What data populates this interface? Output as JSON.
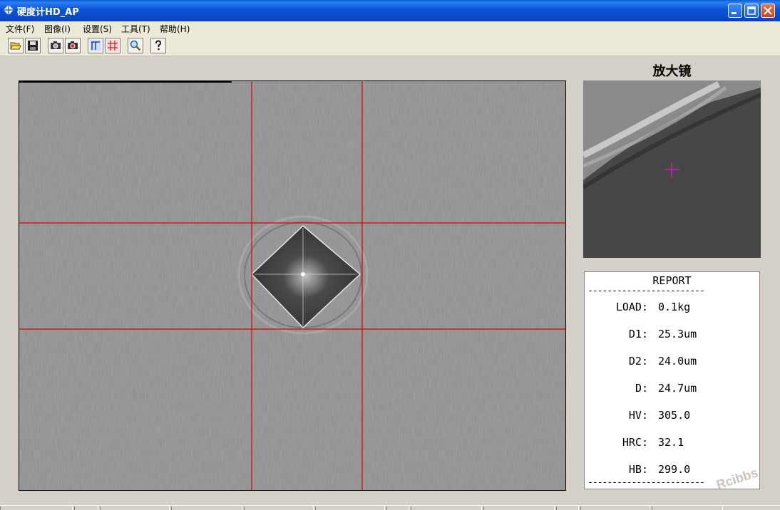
{
  "window": {
    "title": "硬度计HD_AP"
  },
  "menu": [
    {
      "label": "文件(F)"
    },
    {
      "label": "图像(I)"
    },
    {
      "label": "设置(S)"
    },
    {
      "label": "工具(T)"
    },
    {
      "label": "帮助(H)"
    }
  ],
  "toolbar": {
    "buttons": [
      {
        "icon": "open-folder-icon"
      },
      {
        "icon": "save-icon"
      },
      {
        "icon": "camera-icon"
      },
      {
        "icon": "camera-capture-icon"
      },
      {
        "icon": "measure-lines-icon"
      },
      {
        "icon": "grid-icon"
      },
      {
        "icon": "magnifier-icon"
      },
      {
        "icon": "help-icon"
      }
    ]
  },
  "magnifier": {
    "title": "放大镜"
  },
  "report": {
    "title": "REPORT",
    "separator": "------------------------",
    "rows": [
      {
        "label": "LOAD:",
        "value": "0.1kg"
      },
      {
        "label": "D1:",
        "value": "25.3um"
      },
      {
        "label": "D2:",
        "value": "24.0um"
      },
      {
        "label": "D:",
        "value": "24.7um"
      },
      {
        "label": "HV:",
        "value": "305.0"
      },
      {
        "label": "HRC:",
        "value": "32.1"
      },
      {
        "label": "HB:",
        "value": "299.0"
      }
    ]
  },
  "watermark": "Rcibbs",
  "colors": {
    "crosshair": "#e00000",
    "magnifier_cross": "#d020d0",
    "titlebar": "#0b55d6"
  }
}
